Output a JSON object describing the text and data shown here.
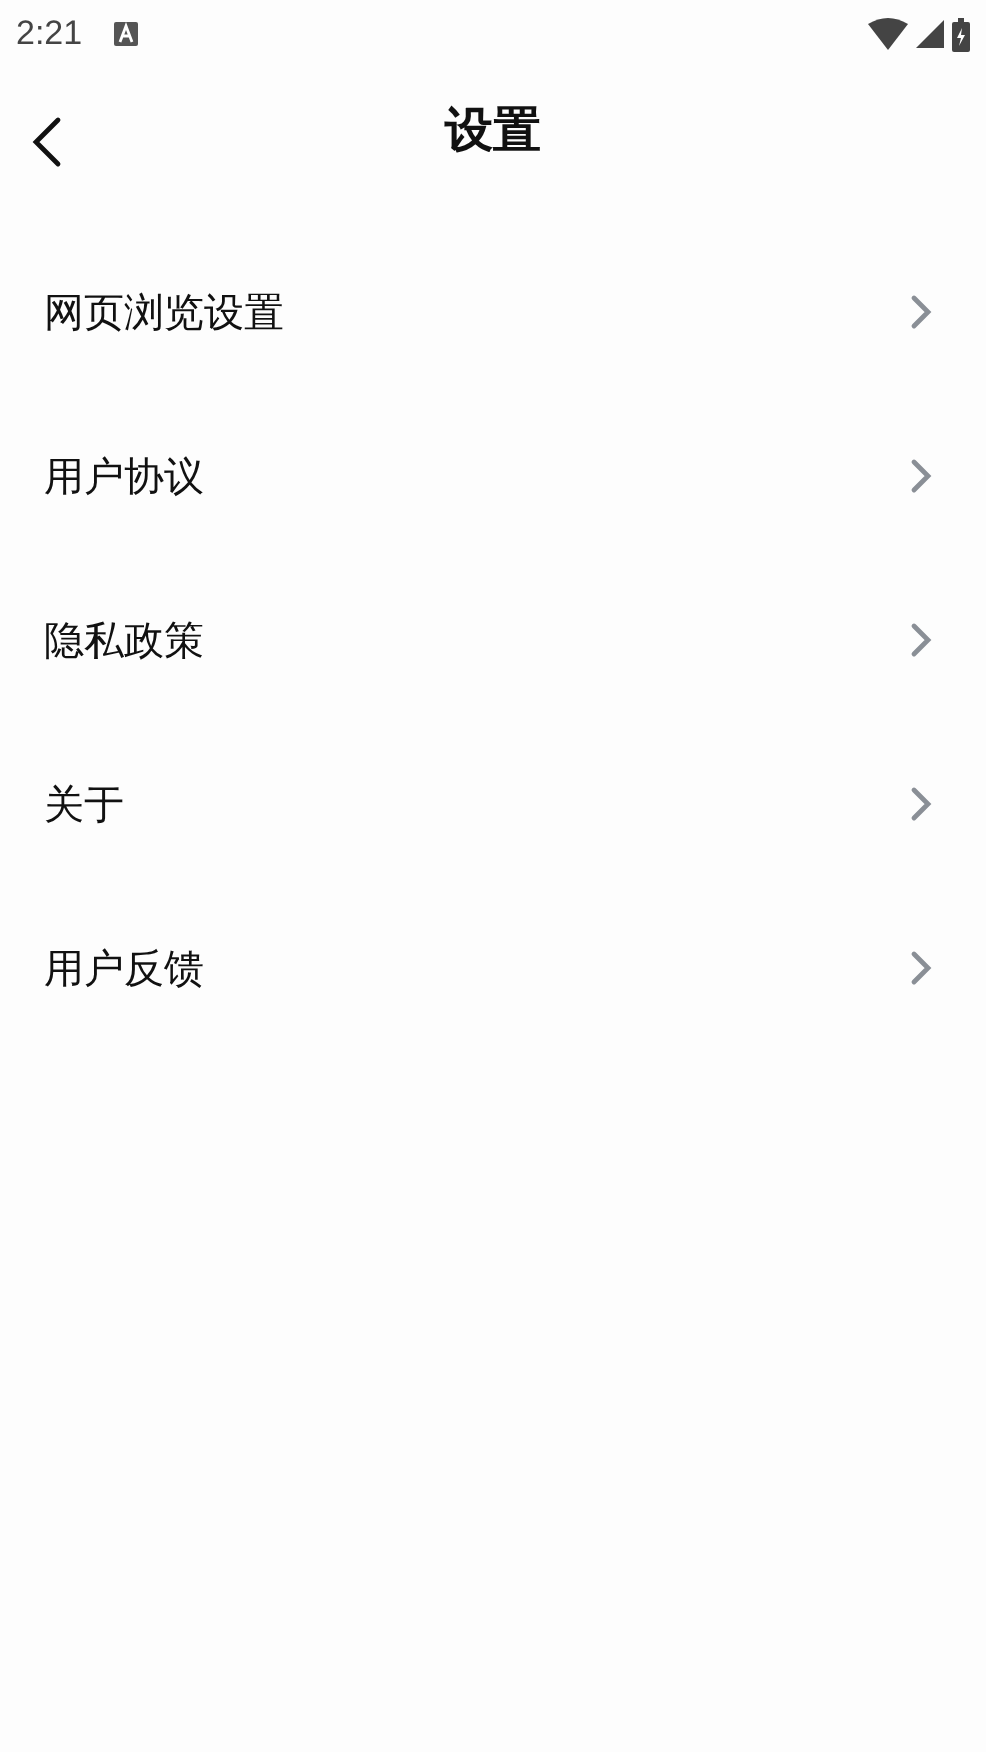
{
  "status_bar": {
    "time": "2:21"
  },
  "header": {
    "title": "设置"
  },
  "items": [
    {
      "label": "网页浏览设置"
    },
    {
      "label": "用户协议"
    },
    {
      "label": "隐私政策"
    },
    {
      "label": "关于"
    },
    {
      "label": "用户反馈"
    }
  ]
}
